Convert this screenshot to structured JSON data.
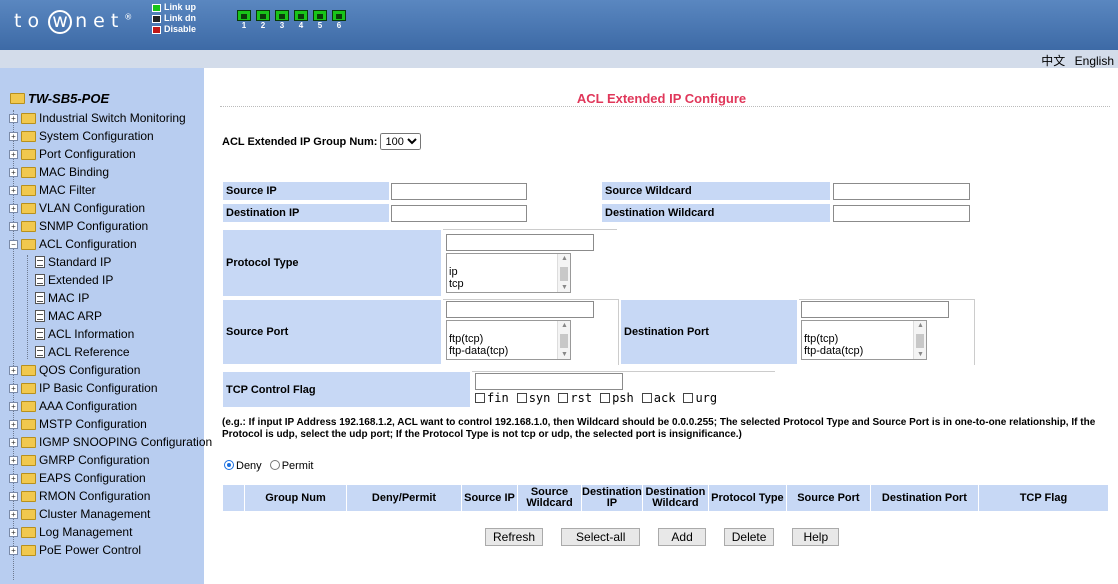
{
  "header": {
    "logo": [
      "t",
      "o",
      "w",
      "n",
      "e",
      "t"
    ],
    "legend": {
      "link_up": "Link up",
      "link_dn": "Link dn",
      "disable": "Disable"
    },
    "ports": [
      "1",
      "2",
      "3",
      "4",
      "5",
      "6"
    ]
  },
  "lang": {
    "zh": "中文",
    "en": "English"
  },
  "sidebar": {
    "title": "TW-SB5-POE",
    "items": [
      "Industrial Switch Monitoring",
      "System Configuration",
      "Port Configuration",
      "MAC Binding",
      "MAC Filter",
      "VLAN Configuration",
      "SNMP Configuration",
      "ACL Configuration",
      "Standard IP",
      "Extended IP",
      "MAC IP",
      "MAC ARP",
      "ACL Information",
      "ACL Reference",
      "QOS Configuration",
      "IP Basic Configuration",
      "AAA Configuration",
      "MSTP Configuration",
      "IGMP SNOOPING Configuration",
      "GMRP Configuration",
      "EAPS Configuration",
      "RMON Configuration",
      "Cluster Management",
      "Log Management",
      "PoE Power Control"
    ]
  },
  "main": {
    "title": "ACL Extended IP Configure",
    "group_label": "ACL Extended IP Group Num:",
    "group_value": "100",
    "source_ip": "Source IP",
    "source_wildcard": "Source Wildcard",
    "dest_ip": "Destination IP",
    "dest_wildcard": "Destination Wildcard",
    "protocol_type": "Protocol Type",
    "protocol_options": [
      "ip",
      "tcp"
    ],
    "source_port": "Source Port",
    "dest_port": "Destination Port",
    "port_options": [
      "ftp(tcp)",
      "ftp-data(tcp)"
    ],
    "tcp_flag": "TCP Control Flag",
    "flags": [
      "fin",
      "syn",
      "rst",
      "psh",
      "ack",
      "urg"
    ],
    "note": "(e.g.: If input IP Address 192.168.1.2, ACL want to control 192.168.1.0, then Wildcard should be 0.0.0.255; The selected Protocol Type and Source Port is in one-to-one relationship, If the Protocol is udp, select the udp port; If the Protocol Type is not tcp or udp, the selected port is insignificance.)",
    "deny": "Deny",
    "permit": "Permit",
    "table_headers": [
      "",
      "Group Num",
      "Deny/Permit",
      "Source IP",
      "Source Wildcard",
      "Destination IP",
      "Destination Wildcard",
      "Protocol Type",
      "Source Port",
      "Destination Port",
      "TCP Flag"
    ],
    "buttons": {
      "refresh": "Refresh",
      "select_all": "Select-all",
      "add": "Add",
      "delete": "Delete",
      "help": "Help"
    }
  },
  "colors": {
    "header": "#4a78b4",
    "sidebar": "#b8cdf0",
    "label_bg": "#c7d8f5",
    "title": "#e0375a"
  }
}
